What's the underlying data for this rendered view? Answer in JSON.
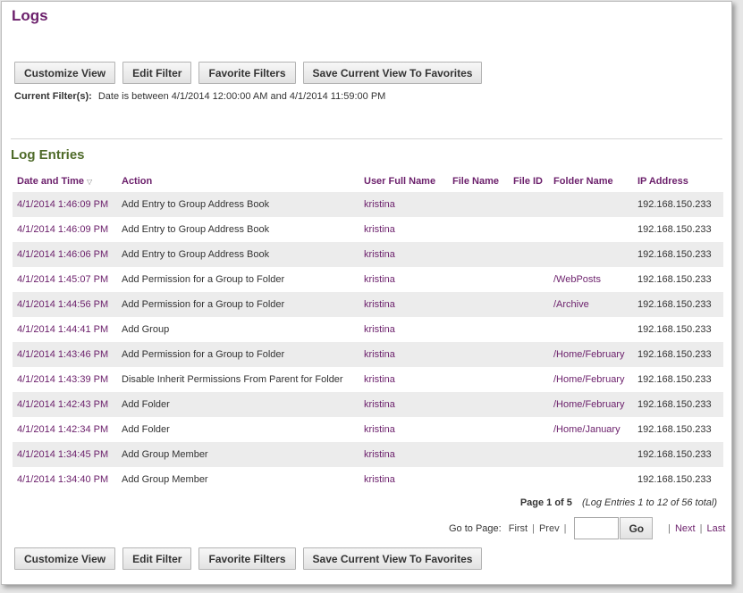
{
  "page": {
    "title": "Logs"
  },
  "toolbar": {
    "customize_view": "Customize View",
    "edit_filter": "Edit Filter",
    "favorite_filters": "Favorite Filters",
    "save_view": "Save Current View To Favorites"
  },
  "filter": {
    "label": "Current Filter(s):",
    "text": "Date is between 4/1/2014 12:00:00 AM and 4/1/2014 11:59:00 PM"
  },
  "section": {
    "title": "Log Entries"
  },
  "table": {
    "columns": [
      "Date and Time",
      "Action",
      "User Full Name",
      "File Name",
      "File ID",
      "Folder Name",
      "IP Address"
    ],
    "rows": [
      {
        "date": "4/1/2014 1:46:09 PM",
        "action": "Add Entry to Group Address Book",
        "user": "kristina",
        "file_name": "",
        "file_id": "",
        "folder": "",
        "ip": "192.168.150.233"
      },
      {
        "date": "4/1/2014 1:46:09 PM",
        "action": "Add Entry to Group Address Book",
        "user": "kristina",
        "file_name": "",
        "file_id": "",
        "folder": "",
        "ip": "192.168.150.233"
      },
      {
        "date": "4/1/2014 1:46:06 PM",
        "action": "Add Entry to Group Address Book",
        "user": "kristina",
        "file_name": "",
        "file_id": "",
        "folder": "",
        "ip": "192.168.150.233"
      },
      {
        "date": "4/1/2014 1:45:07 PM",
        "action": "Add Permission for a Group to Folder",
        "user": "kristina",
        "file_name": "",
        "file_id": "",
        "folder": "/WebPosts",
        "ip": "192.168.150.233"
      },
      {
        "date": "4/1/2014 1:44:56 PM",
        "action": "Add Permission for a Group to Folder",
        "user": "kristina",
        "file_name": "",
        "file_id": "",
        "folder": "/Archive",
        "ip": "192.168.150.233"
      },
      {
        "date": "4/1/2014 1:44:41 PM",
        "action": "Add Group",
        "user": "kristina",
        "file_name": "",
        "file_id": "",
        "folder": "",
        "ip": "192.168.150.233"
      },
      {
        "date": "4/1/2014 1:43:46 PM",
        "action": "Add Permission for a Group to Folder",
        "user": "kristina",
        "file_name": "",
        "file_id": "",
        "folder": "/Home/February",
        "ip": "192.168.150.233"
      },
      {
        "date": "4/1/2014 1:43:39 PM",
        "action": "Disable Inherit Permissions From Parent for Folder",
        "user": "kristina",
        "file_name": "",
        "file_id": "",
        "folder": "/Home/February",
        "ip": "192.168.150.233"
      },
      {
        "date": "4/1/2014 1:42:43 PM",
        "action": "Add Folder",
        "user": "kristina",
        "file_name": "",
        "file_id": "",
        "folder": "/Home/February",
        "ip": "192.168.150.233"
      },
      {
        "date": "4/1/2014 1:42:34 PM",
        "action": "Add Folder",
        "user": "kristina",
        "file_name": "",
        "file_id": "",
        "folder": "/Home/January",
        "ip": "192.168.150.233"
      },
      {
        "date": "4/1/2014 1:34:45 PM",
        "action": "Add Group Member",
        "user": "kristina",
        "file_name": "",
        "file_id": "",
        "folder": "",
        "ip": "192.168.150.233"
      },
      {
        "date": "4/1/2014 1:34:40 PM",
        "action": "Add Group Member",
        "user": "kristina",
        "file_name": "",
        "file_id": "",
        "folder": "",
        "ip": "192.168.150.233"
      }
    ]
  },
  "pagination": {
    "page_text": "Page 1 of 5",
    "total_text": "(Log Entries 1 to 12 of 56 total)",
    "goto_label": "Go to Page:",
    "first": "First",
    "prev": "Prev",
    "go": "Go",
    "next": "Next",
    "last": "Last",
    "separator": "|",
    "input_value": ""
  },
  "colors": {
    "accent": "#6b1f6b",
    "section": "#4f6b2a",
    "row_alt": "#ececec"
  },
  "icons": {
    "sort": "sort-descending-icon"
  }
}
